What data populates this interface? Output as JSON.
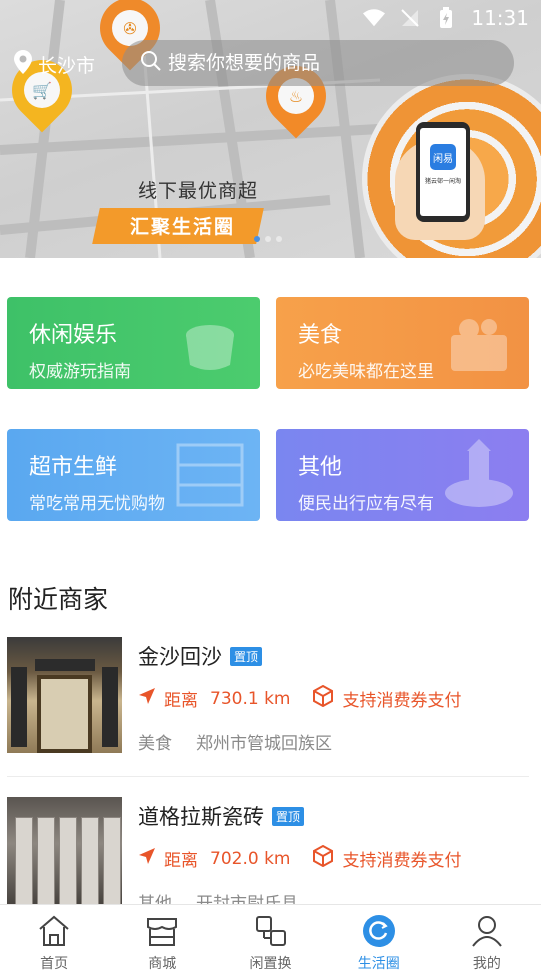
{
  "status_bar": {
    "time": "11:31"
  },
  "header": {
    "location": "长沙市",
    "search_placeholder": "搜索你想要的商品"
  },
  "banner": {
    "line1": "线下最优商超",
    "line2": "汇聚生活圈",
    "phone_logo": "闲易",
    "phone_caption": "猪云邨一闲淘",
    "slides": 3,
    "active_slide": 1
  },
  "categories": [
    {
      "title": "休闲娱乐",
      "subtitle": "权威游玩指南",
      "color": "#46c66b"
    },
    {
      "title": "美食",
      "subtitle": "必吃美味都在这里",
      "color": "#f59a47"
    },
    {
      "title": "超市生鲜",
      "subtitle": "常吃常用无忧购物",
      "color": "#62adf2"
    },
    {
      "title": "其他",
      "subtitle": "便民出行应有尽有",
      "color": "#8282f0"
    }
  ],
  "nearby": {
    "title": "附近商家",
    "merchants": [
      {
        "name": "金沙回沙",
        "badge": "置顶",
        "distance_label": "距离",
        "distance": "730.1 km",
        "voucher": "支持消费券支付",
        "category": "美食",
        "region": "郑州市管城回族区"
      },
      {
        "name": "道格拉斯瓷砖",
        "badge": "置顶",
        "distance_label": "距离",
        "distance": "702.0 km",
        "voucher": "支持消费券支付",
        "category": "其他",
        "region": "开封市尉氏县"
      }
    ]
  },
  "tabbar": {
    "items": [
      {
        "label": "首页",
        "icon": "home-icon"
      },
      {
        "label": "商城",
        "icon": "shop-icon"
      },
      {
        "label": "闲置换",
        "icon": "exchange-icon"
      },
      {
        "label": "生活圈",
        "icon": "life-circle-icon",
        "active": true
      },
      {
        "label": "我的",
        "icon": "profile-icon"
      }
    ]
  },
  "colors": {
    "accent": "#2d8fe5",
    "distance_text": "#e8552a",
    "muted_text": "#8a8a8a"
  }
}
